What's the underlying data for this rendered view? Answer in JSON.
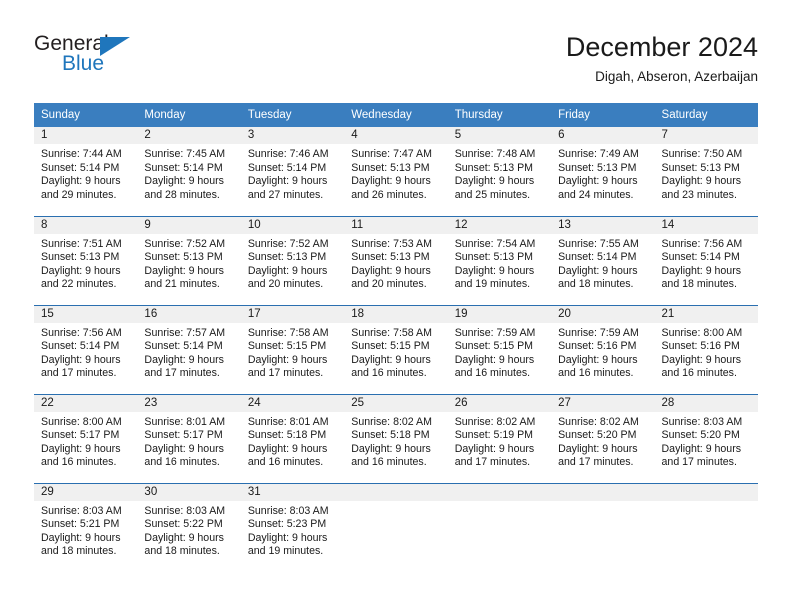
{
  "brand": {
    "name_part1": "General",
    "name_part2": "Blue",
    "triangle_icon": "blue-triangle-logo-mark",
    "accent_color": "#1f76bc"
  },
  "header": {
    "title": "December 2024",
    "subtitle": "Digah, Abseron, Azerbaijan"
  },
  "calendar": {
    "header_bg": "#3a7ebf",
    "daynum_bg": "#f0f0f0",
    "row_separator_color": "#2a6fb0",
    "weekdays": [
      "Sunday",
      "Monday",
      "Tuesday",
      "Wednesday",
      "Thursday",
      "Friday",
      "Saturday"
    ],
    "weeks": [
      [
        {
          "day": "1",
          "sunrise": "Sunrise: 7:44 AM",
          "sunset": "Sunset: 5:14 PM",
          "daylight": "Daylight: 9 hours and 29 minutes."
        },
        {
          "day": "2",
          "sunrise": "Sunrise: 7:45 AM",
          "sunset": "Sunset: 5:14 PM",
          "daylight": "Daylight: 9 hours and 28 minutes."
        },
        {
          "day": "3",
          "sunrise": "Sunrise: 7:46 AM",
          "sunset": "Sunset: 5:14 PM",
          "daylight": "Daylight: 9 hours and 27 minutes."
        },
        {
          "day": "4",
          "sunrise": "Sunrise: 7:47 AM",
          "sunset": "Sunset: 5:13 PM",
          "daylight": "Daylight: 9 hours and 26 minutes."
        },
        {
          "day": "5",
          "sunrise": "Sunrise: 7:48 AM",
          "sunset": "Sunset: 5:13 PM",
          "daylight": "Daylight: 9 hours and 25 minutes."
        },
        {
          "day": "6",
          "sunrise": "Sunrise: 7:49 AM",
          "sunset": "Sunset: 5:13 PM",
          "daylight": "Daylight: 9 hours and 24 minutes."
        },
        {
          "day": "7",
          "sunrise": "Sunrise: 7:50 AM",
          "sunset": "Sunset: 5:13 PM",
          "daylight": "Daylight: 9 hours and 23 minutes."
        }
      ],
      [
        {
          "day": "8",
          "sunrise": "Sunrise: 7:51 AM",
          "sunset": "Sunset: 5:13 PM",
          "daylight": "Daylight: 9 hours and 22 minutes."
        },
        {
          "day": "9",
          "sunrise": "Sunrise: 7:52 AM",
          "sunset": "Sunset: 5:13 PM",
          "daylight": "Daylight: 9 hours and 21 minutes."
        },
        {
          "day": "10",
          "sunrise": "Sunrise: 7:52 AM",
          "sunset": "Sunset: 5:13 PM",
          "daylight": "Daylight: 9 hours and 20 minutes."
        },
        {
          "day": "11",
          "sunrise": "Sunrise: 7:53 AM",
          "sunset": "Sunset: 5:13 PM",
          "daylight": "Daylight: 9 hours and 20 minutes."
        },
        {
          "day": "12",
          "sunrise": "Sunrise: 7:54 AM",
          "sunset": "Sunset: 5:13 PM",
          "daylight": "Daylight: 9 hours and 19 minutes."
        },
        {
          "day": "13",
          "sunrise": "Sunrise: 7:55 AM",
          "sunset": "Sunset: 5:14 PM",
          "daylight": "Daylight: 9 hours and 18 minutes."
        },
        {
          "day": "14",
          "sunrise": "Sunrise: 7:56 AM",
          "sunset": "Sunset: 5:14 PM",
          "daylight": "Daylight: 9 hours and 18 minutes."
        }
      ],
      [
        {
          "day": "15",
          "sunrise": "Sunrise: 7:56 AM",
          "sunset": "Sunset: 5:14 PM",
          "daylight": "Daylight: 9 hours and 17 minutes."
        },
        {
          "day": "16",
          "sunrise": "Sunrise: 7:57 AM",
          "sunset": "Sunset: 5:14 PM",
          "daylight": "Daylight: 9 hours and 17 minutes."
        },
        {
          "day": "17",
          "sunrise": "Sunrise: 7:58 AM",
          "sunset": "Sunset: 5:15 PM",
          "daylight": "Daylight: 9 hours and 17 minutes."
        },
        {
          "day": "18",
          "sunrise": "Sunrise: 7:58 AM",
          "sunset": "Sunset: 5:15 PM",
          "daylight": "Daylight: 9 hours and 16 minutes."
        },
        {
          "day": "19",
          "sunrise": "Sunrise: 7:59 AM",
          "sunset": "Sunset: 5:15 PM",
          "daylight": "Daylight: 9 hours and 16 minutes."
        },
        {
          "day": "20",
          "sunrise": "Sunrise: 7:59 AM",
          "sunset": "Sunset: 5:16 PM",
          "daylight": "Daylight: 9 hours and 16 minutes."
        },
        {
          "day": "21",
          "sunrise": "Sunrise: 8:00 AM",
          "sunset": "Sunset: 5:16 PM",
          "daylight": "Daylight: 9 hours and 16 minutes."
        }
      ],
      [
        {
          "day": "22",
          "sunrise": "Sunrise: 8:00 AM",
          "sunset": "Sunset: 5:17 PM",
          "daylight": "Daylight: 9 hours and 16 minutes."
        },
        {
          "day": "23",
          "sunrise": "Sunrise: 8:01 AM",
          "sunset": "Sunset: 5:17 PM",
          "daylight": "Daylight: 9 hours and 16 minutes."
        },
        {
          "day": "24",
          "sunrise": "Sunrise: 8:01 AM",
          "sunset": "Sunset: 5:18 PM",
          "daylight": "Daylight: 9 hours and 16 minutes."
        },
        {
          "day": "25",
          "sunrise": "Sunrise: 8:02 AM",
          "sunset": "Sunset: 5:18 PM",
          "daylight": "Daylight: 9 hours and 16 minutes."
        },
        {
          "day": "26",
          "sunrise": "Sunrise: 8:02 AM",
          "sunset": "Sunset: 5:19 PM",
          "daylight": "Daylight: 9 hours and 17 minutes."
        },
        {
          "day": "27",
          "sunrise": "Sunrise: 8:02 AM",
          "sunset": "Sunset: 5:20 PM",
          "daylight": "Daylight: 9 hours and 17 minutes."
        },
        {
          "day": "28",
          "sunrise": "Sunrise: 8:03 AM",
          "sunset": "Sunset: 5:20 PM",
          "daylight": "Daylight: 9 hours and 17 minutes."
        }
      ],
      [
        {
          "day": "29",
          "sunrise": "Sunrise: 8:03 AM",
          "sunset": "Sunset: 5:21 PM",
          "daylight": "Daylight: 9 hours and 18 minutes."
        },
        {
          "day": "30",
          "sunrise": "Sunrise: 8:03 AM",
          "sunset": "Sunset: 5:22 PM",
          "daylight": "Daylight: 9 hours and 18 minutes."
        },
        {
          "day": "31",
          "sunrise": "Sunrise: 8:03 AM",
          "sunset": "Sunset: 5:23 PM",
          "daylight": "Daylight: 9 hours and 19 minutes."
        },
        {
          "day": "",
          "sunrise": "",
          "sunset": "",
          "daylight": ""
        },
        {
          "day": "",
          "sunrise": "",
          "sunset": "",
          "daylight": ""
        },
        {
          "day": "",
          "sunrise": "",
          "sunset": "",
          "daylight": ""
        },
        {
          "day": "",
          "sunrise": "",
          "sunset": "",
          "daylight": ""
        }
      ]
    ]
  }
}
